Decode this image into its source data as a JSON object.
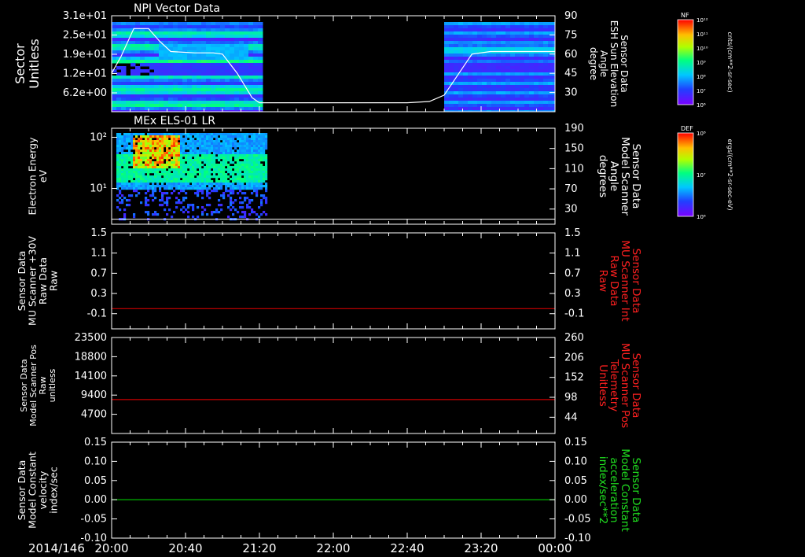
{
  "colors": {
    "background": "#000000",
    "axis": "#ffffff",
    "trace_red": "#cc0000",
    "trace_green": "#00cc00",
    "label_red": "#ff2020",
    "label_green": "#20e020"
  },
  "footer": {
    "date": "2014/146"
  },
  "x_axis": {
    "range": [
      "20:00",
      "24:00"
    ],
    "tick_labels": [
      "20:00",
      "20:40",
      "21:20",
      "22:00",
      "22:40",
      "23:20",
      "00:00"
    ]
  },
  "chart_data": [
    {
      "type": "heatmap",
      "title": "NPI Vector Data",
      "ylabel_lines": [
        "Sector",
        "Unitless"
      ],
      "y_ticks": [
        "3.1e+01",
        "2.5e+01",
        "1.9e+01",
        "1.2e+01",
        "6.2e+00"
      ],
      "y_tick_values": [
        31,
        25,
        19,
        12,
        6.2
      ],
      "ylim": [
        1,
        31
      ],
      "y2label_lines": [
        "Sensor Data",
        "ESH Sun Elevation",
        "Angle",
        "degree"
      ],
      "y2_ticks": [
        "90",
        "75",
        "60",
        "45",
        "30"
      ],
      "y2_tick_values": [
        90,
        75,
        60,
        45,
        30
      ],
      "y2lim": [
        15,
        90
      ],
      "data_gap": [
        "21:20",
        "23:00"
      ],
      "colorbar": {
        "label": "NF",
        "unit": "cnts/(cm**2-sr-sec)",
        "ticks": [
          "10¹²",
          "10¹¹",
          "10¹⁰",
          "10⁹",
          "10⁸",
          "10⁷",
          "10⁶"
        ]
      },
      "line_series": {
        "name": "ESH Sun Elevation Angle",
        "x": [
          "20:00",
          "20:05",
          "20:12",
          "20:20",
          "20:26",
          "20:32",
          "20:45",
          "20:55",
          "21:00",
          "21:08",
          "21:16",
          "21:20",
          "22:00",
          "22:40",
          "22:52",
          "23:00",
          "23:08",
          "23:15",
          "23:25",
          "24:00"
        ],
        "y": [
          45,
          58,
          80,
          80,
          70,
          62,
          61,
          61,
          60,
          45,
          26,
          22,
          22,
          22,
          23,
          28,
          45,
          60,
          62,
          62
        ]
      }
    },
    {
      "type": "heatmap",
      "title": "MEx ELS-01 LR",
      "ylabel_lines": [
        "Electron Energy",
        "eV"
      ],
      "y_ticks": [
        "10²",
        "10¹"
      ],
      "y_tick_values": [
        100,
        10
      ],
      "ylim": [
        2,
        150
      ],
      "y_scale": "log",
      "y2label_lines": [
        "Sensor Data",
        "Model Scanner",
        "Angle",
        "degrees"
      ],
      "y2_ticks": [
        "190",
        "150",
        "110",
        "70",
        "30"
      ],
      "y2_tick_values": [
        190,
        150,
        110,
        70,
        30
      ],
      "y2lim": [
        0,
        190
      ],
      "data_range": [
        "20:00",
        "21:24"
      ],
      "colorbar": {
        "label": "DEF",
        "unit": "ergs/(cm**2-sr-sec-eV)",
        "ticks": [
          "10⁸",
          "10⁷",
          "10⁶"
        ]
      },
      "line_series": {
        "name": "Model Scanner Angle",
        "x": [
          "20:00",
          "24:00"
        ],
        "y": [
          10,
          10
        ]
      }
    },
    {
      "type": "line",
      "ylabel_lines": [
        "Sensor Data",
        "MU Scanner +30V",
        "Raw Data",
        "Raw"
      ],
      "y_ticks": [
        "1.5",
        "1.1",
        "0.7",
        "0.3",
        "-0.1"
      ],
      "y_tick_values": [
        1.5,
        1.1,
        0.7,
        0.3,
        -0.1
      ],
      "ylim": [
        -0.4,
        1.5
      ],
      "y2label_lines": [
        "Sensor Data",
        "MU Scanner Int",
        "Raw Data",
        "Raw"
      ],
      "y2_ticks": [
        "1.5",
        "1.1",
        "0.7",
        "0.3",
        "-0.1"
      ],
      "y2_tick_values": [
        1.5,
        1.1,
        0.7,
        0.3,
        -0.1
      ],
      "y2lim": [
        -0.4,
        1.5
      ],
      "line_series": {
        "name": "MU Scanner Int Raw Data",
        "x": [
          "20:00",
          "24:00"
        ],
        "y": [
          0.0,
          0.0
        ],
        "color": "#cc0000"
      }
    },
    {
      "type": "line",
      "ylabel_lines": [
        "Sensor Data",
        "Model Scanner Pos",
        "Raw",
        "unitless"
      ],
      "y_ticks": [
        "23500",
        "18800",
        "14100",
        "9400",
        "4700"
      ],
      "y_tick_values": [
        23500,
        18800,
        14100,
        9400,
        4700
      ],
      "ylim": [
        0,
        23500
      ],
      "y2label_lines": [
        "Sensor Data",
        "MU Scanner Pos",
        "Telemetry",
        "Unitless"
      ],
      "y2_ticks": [
        "260",
        "206",
        "152",
        "98",
        "44"
      ],
      "y2_tick_values": [
        260,
        206,
        152,
        98,
        44
      ],
      "y2lim": [
        0,
        260
      ],
      "line_series": {
        "name": "MU Scanner Pos Telemetry",
        "x": [
          "20:00",
          "24:00"
        ],
        "y": [
          8300,
          8300
        ],
        "color": "#cc0000"
      }
    },
    {
      "type": "line",
      "ylabel_lines": [
        "Sensor Data",
        "Model Constant",
        "velocity",
        "index/sec"
      ],
      "y_ticks": [
        "0.15",
        "0.10",
        "0.05",
        "0.00",
        "-0.05",
        "-0.10"
      ],
      "y_tick_values": [
        0.15,
        0.1,
        0.05,
        0.0,
        -0.05,
        -0.1
      ],
      "ylim": [
        -0.1,
        0.15
      ],
      "y2label_lines": [
        "Sensor Data",
        "Model Constant",
        "acceleration",
        "index/sec**2"
      ],
      "y2_ticks": [
        "0.15",
        "0.10",
        "0.05",
        "0.00",
        "-0.05",
        "-0.10"
      ],
      "y2_tick_values": [
        0.15,
        0.1,
        0.05,
        0.0,
        -0.05,
        -0.1
      ],
      "y2lim": [
        -0.1,
        0.15
      ],
      "line_series": {
        "name": "Model Constant acceleration",
        "x": [
          "20:00",
          "24:00"
        ],
        "y": [
          0.0,
          0.0
        ],
        "color": "#00cc00"
      }
    }
  ]
}
